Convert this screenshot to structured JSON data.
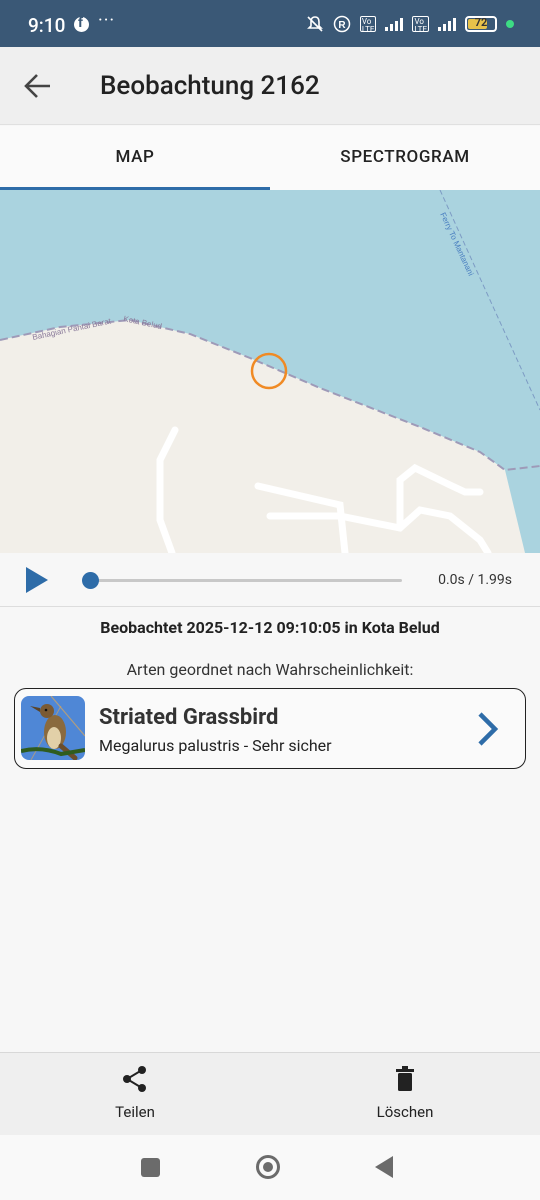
{
  "status_bar": {
    "time": "9:10",
    "dots": "···",
    "battery": "72",
    "icons": [
      "facebook-icon",
      "mute-icon",
      "registered-icon",
      "volte-icon",
      "signal-icon",
      "volte-icon",
      "4g-signal-icon",
      "battery-icon",
      "dot-indicator"
    ]
  },
  "app_bar": {
    "title": "Beobachtung 2162"
  },
  "tabs": [
    {
      "label": "MAP",
      "active": true
    },
    {
      "label": "SPECTROGRAM",
      "active": false
    }
  ],
  "map": {
    "labels": {
      "road_1": "Bahagian Pantai Barat",
      "road_2": "Kota Belud",
      "ferry": "Ferry To Mantanani"
    },
    "colors": {
      "water": "#aad3df",
      "land": "#f2efe9",
      "marker": "#f08a24"
    }
  },
  "player": {
    "time": "0.0s / 1.99s",
    "progress": 0
  },
  "observation": {
    "observed_text": "Beobachtet 2025-12-12 09:10:05 in Kota Belud",
    "sorted_heading": "Arten geordnet nach Wahrscheinlichkeit:"
  },
  "species": [
    {
      "common_name": "Striated Grassbird",
      "detail": "Megalurus palustris - Sehr sicher"
    }
  ],
  "bottom_bar": {
    "share_label": "Teilen",
    "delete_label": "Löschen"
  },
  "colors": {
    "status_bar": "#3a5876",
    "accent": "#2e6ca8"
  }
}
